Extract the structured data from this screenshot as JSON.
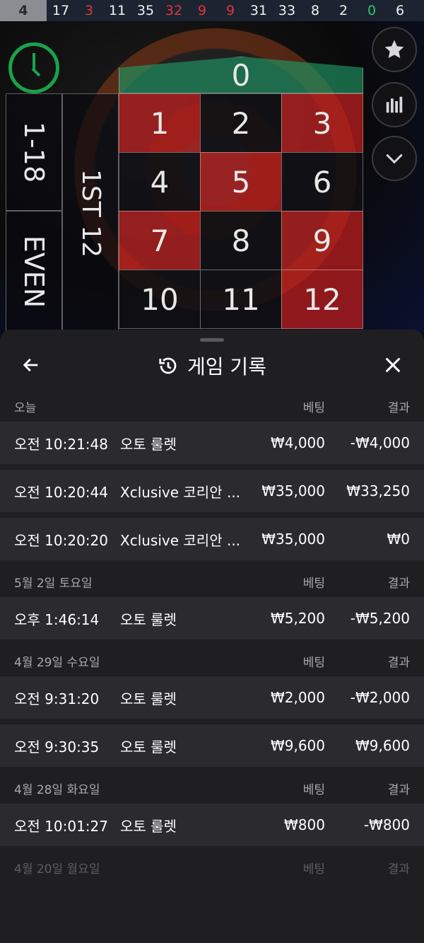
{
  "history": [
    {
      "n": "4",
      "c": "first"
    },
    {
      "n": "17",
      "c": "black"
    },
    {
      "n": "3",
      "c": "red"
    },
    {
      "n": "11",
      "c": "black"
    },
    {
      "n": "35",
      "c": "black"
    },
    {
      "n": "32",
      "c": "red"
    },
    {
      "n": "9",
      "c": "red"
    },
    {
      "n": "9",
      "c": "red"
    },
    {
      "n": "31",
      "c": "black"
    },
    {
      "n": "33",
      "c": "black"
    },
    {
      "n": "8",
      "c": "black"
    },
    {
      "n": "2",
      "c": "black"
    },
    {
      "n": "0",
      "c": "green"
    },
    {
      "n": "6",
      "c": "black"
    }
  ],
  "board": {
    "zero": "0",
    "low": "1-18",
    "even": "EVEN",
    "dozen": "1ST 12",
    "numbers": [
      "1",
      "2",
      "3",
      "4",
      "5",
      "6",
      "7",
      "8",
      "9",
      "10",
      "11",
      "12"
    ]
  },
  "sheet": {
    "title": "게임 기록",
    "bet_header": "베팅",
    "result_header": "결과",
    "sections": [
      {
        "date": "오늘",
        "rows": [
          {
            "time": "오전 10:21:48",
            "game": "오토 룰렛",
            "bet": "₩4,000",
            "result": "-₩4,000"
          },
          {
            "time": "오전 10:20:44",
            "game": "Xclusive 코리안 ...",
            "bet": "₩35,000",
            "result": "₩33,250"
          },
          {
            "time": "오전 10:20:20",
            "game": "Xclusive 코리안 ...",
            "bet": "₩35,000",
            "result": "₩0"
          }
        ]
      },
      {
        "date": "5월 2일 토요일",
        "rows": [
          {
            "time": "오후 1:46:14",
            "game": "오토 룰렛",
            "bet": "₩5,200",
            "result": "-₩5,200"
          }
        ]
      },
      {
        "date": "4월 29일 수요일",
        "rows": [
          {
            "time": "오전 9:31:20",
            "game": "오토 룰렛",
            "bet": "₩2,000",
            "result": "-₩2,000"
          },
          {
            "time": "오전 9:30:35",
            "game": "오토 룰렛",
            "bet": "₩9,600",
            "result": "₩9,600"
          }
        ]
      },
      {
        "date": "4월 28일 화요일",
        "rows": [
          {
            "time": "오전 10:01:27",
            "game": "오토 룰렛",
            "bet": "₩800",
            "result": "-₩800"
          }
        ]
      },
      {
        "date": "4월 20일 월요일",
        "rows": []
      }
    ]
  }
}
